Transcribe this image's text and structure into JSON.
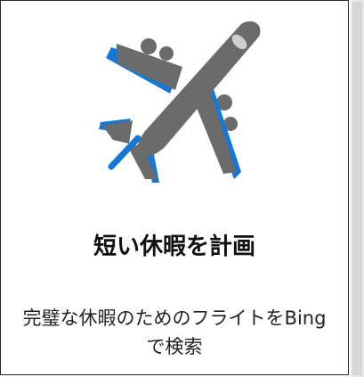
{
  "card": {
    "title": "短い休暇を計画",
    "description": "完璧な休暇のためのフライトをBingで検索",
    "illustration_icon": "airplane-icon"
  },
  "colors": {
    "plane_body": "#6b6b6b",
    "plane_accent": "#1479d4",
    "card_border": "#2b2b2b"
  }
}
